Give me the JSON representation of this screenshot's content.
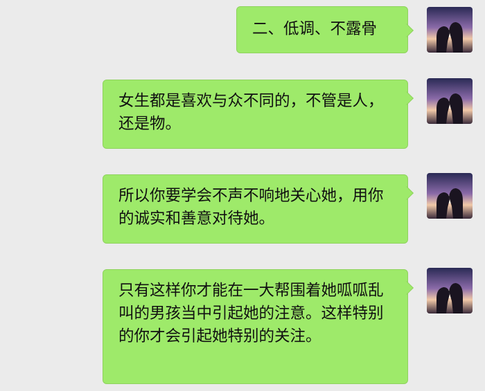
{
  "messages": [
    {
      "text": "二、低调、不露骨"
    },
    {
      "text": "女生都是喜欢与众不同的，不管是人，还是物。"
    },
    {
      "text": "所以你要学会不声不响地关心她，用你的诚实和善意对待她。"
    },
    {
      "text": "只有这样你才能在一大帮围着她呱呱乱叫的男孩当中引起她的注意。这样特别的你才会引起她特别的关注。"
    }
  ],
  "colors": {
    "background": "#ebebeb",
    "bubble": "#9eea6a",
    "bubble_border": "#8fd25e",
    "text": "#111111"
  },
  "icons": {
    "avatar": "couple-silhouette-sunset-avatar"
  }
}
